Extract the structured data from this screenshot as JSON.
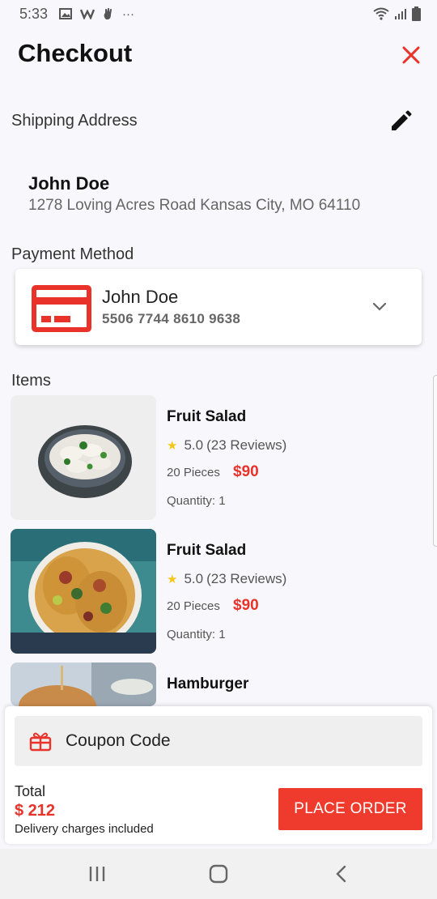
{
  "status_bar": {
    "time": "5:33",
    "left_icons": [
      "image-icon",
      "w-icon",
      "hand-icon",
      "more-icon"
    ],
    "right_icons": [
      "wifi-icon",
      "signal-icon",
      "battery-icon"
    ],
    "more_glyph": "···"
  },
  "header": {
    "title": "Checkout",
    "close_icon": "close-icon",
    "accent": "#e8322a"
  },
  "shipping": {
    "label": "Shipping Address",
    "name": "John Doe",
    "address": "1278 Loving Acres Road Kansas City, MO 64110",
    "edit_icon": "pencil-icon"
  },
  "payment": {
    "label": "Payment Method",
    "card_holder": "John Doe",
    "card_number": "5506 7744 8610 9638",
    "card_icon": "credit-card-icon",
    "dropdown_icon": "chevron-down-icon"
  },
  "items": {
    "label": "Items",
    "list": [
      {
        "name": "Fruit Salad",
        "rating": "5.0",
        "reviews": "(23 Reviews)",
        "pieces": "20 Pieces",
        "price": "$90",
        "quantity": "Quantity: 1"
      },
      {
        "name": "Fruit Salad",
        "rating": "5.0",
        "reviews": "(23 Reviews)",
        "pieces": "20 Pieces",
        "price": "$90",
        "quantity": "Quantity: 1"
      },
      {
        "name": "Hamburger"
      }
    ]
  },
  "checkout_panel": {
    "coupon_label": "Coupon Code",
    "coupon_icon": "gift-icon",
    "total_label": "Total",
    "total_amount": "$ 212",
    "delivery_note": "Delivery charges included",
    "place_order_label": "PLACE ORDER",
    "button_color": "#ef3b2d"
  },
  "nav_bar": {
    "buttons": [
      "recents-icon",
      "home-icon",
      "back-icon"
    ]
  }
}
